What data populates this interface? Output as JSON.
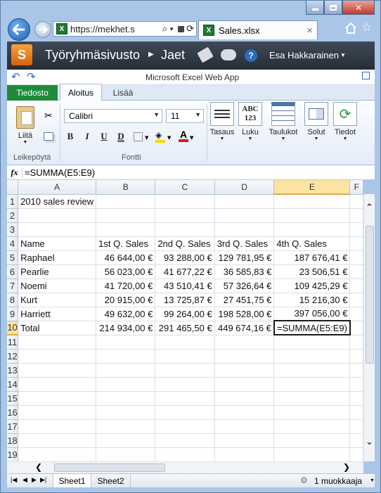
{
  "browser": {
    "address": "https://mekhet.s",
    "tab_title": "Sales.xlsx",
    "tab_close": "×"
  },
  "sharepoint": {
    "site_title": "Työryhmäsivusto",
    "breadcrumb_next": "Jaet",
    "user_name": "Esa Hakkarainen",
    "help": "?"
  },
  "app": {
    "title": "Microsoft Excel Web App"
  },
  "ribbon": {
    "tabs": [
      "Tiedosto",
      "Aloitus",
      "Lisää"
    ],
    "paste_label": "Liitä",
    "clipboard_group": "Leikepöytä",
    "font_group": "Fontti",
    "font_name": "Calibri",
    "font_size": "11",
    "bold": "B",
    "italic": "I",
    "underline": "U",
    "double_underline": "D",
    "align_label": "Tasaus",
    "number_label": "Luku",
    "number_icon_text": "ABC\n123",
    "tables_label": "Taulukot",
    "cells_label": "Solut",
    "data_label": "Tiedot"
  },
  "formula_bar": {
    "fx": "fx",
    "formula": "=SUMMA(E5:E9)"
  },
  "grid": {
    "columns": [
      "A",
      "B",
      "C",
      "D",
      "E",
      "F"
    ],
    "selected_column": "E",
    "selected_row": 10,
    "rows": [
      {
        "n": 1,
        "cells": [
          "2010 sales review",
          "",
          "",
          "",
          "",
          ""
        ]
      },
      {
        "n": 2,
        "cells": [
          "",
          "",
          "",
          "",
          "",
          ""
        ]
      },
      {
        "n": 3,
        "cells": [
          "",
          "",
          "",
          "",
          "",
          ""
        ]
      },
      {
        "n": 4,
        "cells": [
          "Name",
          "1st Q. Sales",
          "2nd Q. Sales",
          "3rd Q. Sales",
          "4th Q. Sales",
          ""
        ]
      },
      {
        "n": 5,
        "cells": [
          "Raphael",
          "46 644,00 €",
          "93 288,00 €",
          "129 781,95 €",
          "187 676,41 €",
          ""
        ]
      },
      {
        "n": 6,
        "cells": [
          "Pearlie",
          "56 023,00 €",
          "41 677,22 €",
          "36 585,83 €",
          "23 506,51 €",
          ""
        ]
      },
      {
        "n": 7,
        "cells": [
          "Noemi",
          "41 720,00 €",
          "43 510,41 €",
          "57 326,64 €",
          "109 425,29 €",
          ""
        ]
      },
      {
        "n": 8,
        "cells": [
          "Kurt",
          "20 915,00 €",
          "13 725,87 €",
          "27 451,75 €",
          "15 216,30 €",
          ""
        ]
      },
      {
        "n": 9,
        "cells": [
          "Harriett",
          "49 632,00 €",
          "99 264,00 €",
          "198 528,00 €",
          "397 056,00 €",
          ""
        ]
      },
      {
        "n": 10,
        "cells": [
          "Total",
          "214 934,00 €",
          "291 465,50 €",
          "449 674,16 €",
          "=SUMMA(E5:E9)",
          ""
        ]
      },
      {
        "n": 11,
        "cells": [
          "",
          "",
          "",
          "",
          "",
          ""
        ]
      },
      {
        "n": 12,
        "cells": [
          "",
          "",
          "",
          "",
          "",
          ""
        ]
      },
      {
        "n": 13,
        "cells": [
          "",
          "",
          "",
          "",
          "",
          ""
        ]
      },
      {
        "n": 14,
        "cells": [
          "",
          "",
          "",
          "",
          "",
          ""
        ]
      },
      {
        "n": 15,
        "cells": [
          "",
          "",
          "",
          "",
          "",
          ""
        ]
      },
      {
        "n": 16,
        "cells": [
          "",
          "",
          "",
          "",
          "",
          ""
        ]
      },
      {
        "n": 17,
        "cells": [
          "",
          "",
          "",
          "",
          "",
          ""
        ]
      },
      {
        "n": 18,
        "cells": [
          "",
          "",
          "",
          "",
          "",
          ""
        ]
      },
      {
        "n": 19,
        "cells": [
          "",
          "",
          "",
          "",
          "",
          ""
        ]
      }
    ]
  },
  "sheets": {
    "tabs": [
      "Sheet1",
      "Sheet2"
    ],
    "editors": "1 muokkaaja"
  },
  "colors": {
    "file_tab": "#1f8b3a",
    "selection": "#fbe3a3",
    "accent": "#2a6cc0"
  },
  "icons": {
    "back": "arrow-left-icon",
    "forward": "arrow-right-icon",
    "search": "search-icon",
    "lock": "lock-icon",
    "refresh": "refresh-icon",
    "home": "home-icon",
    "favorites": "star-icon"
  }
}
